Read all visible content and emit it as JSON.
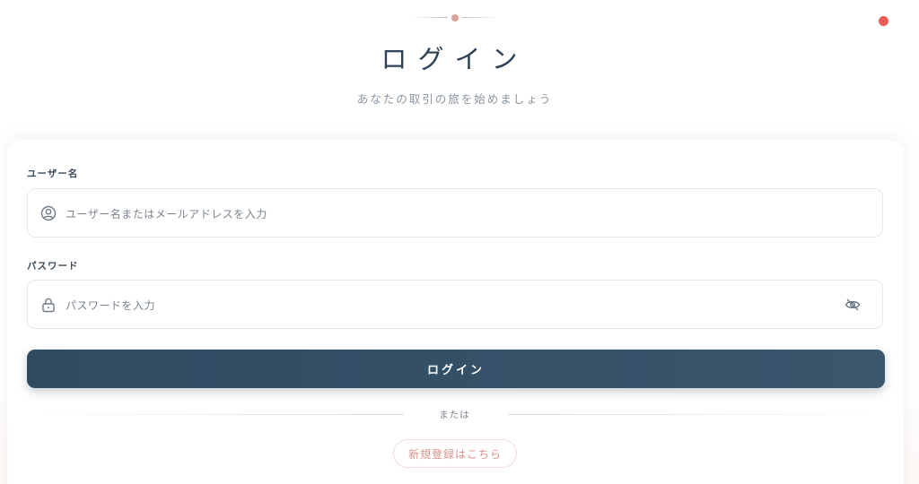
{
  "header": {
    "title": "ログイン",
    "subtitle": "あなたの取引の旅を始めましょう"
  },
  "form": {
    "username": {
      "label": "ユーザー名",
      "placeholder": "ユーザー名またはメールアドレスを入力",
      "icon": "user-circle-icon"
    },
    "password": {
      "label": "パスワード",
      "placeholder": "パスワードを入力",
      "icon": "lock-icon",
      "toggle_icon": "eye-off-icon"
    },
    "login_label": "ログイン",
    "or_text": "または",
    "register_label": "新規登録はこちら"
  },
  "colors": {
    "primary": "#2f4a61",
    "accent": "#d7928a",
    "status_dot": "#ee5d55"
  }
}
